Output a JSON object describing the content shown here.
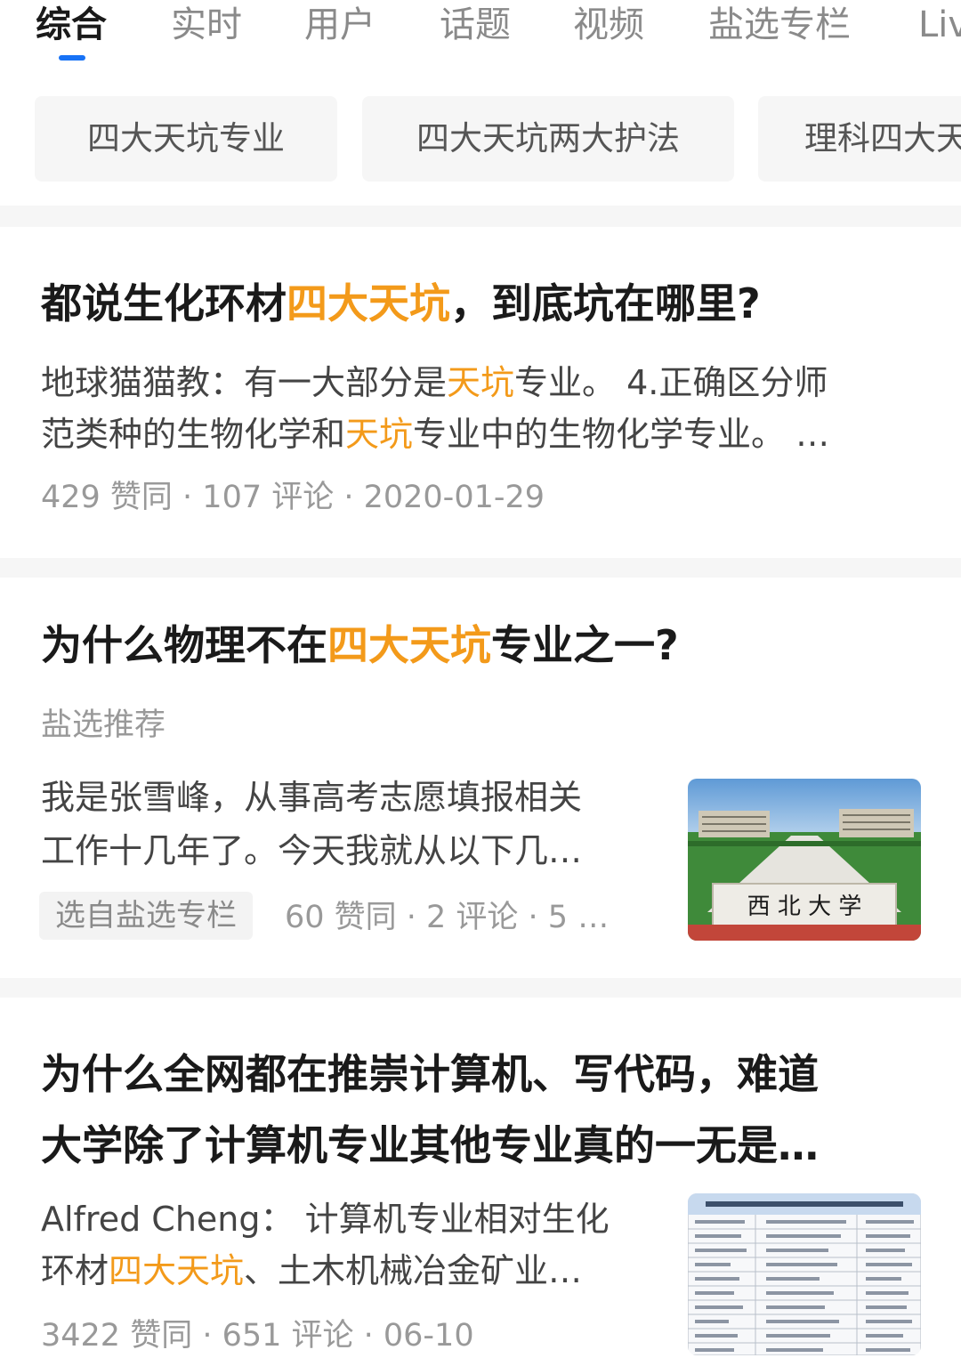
{
  "tabs": [
    {
      "label": "综合",
      "active": true
    },
    {
      "label": "实时"
    },
    {
      "label": "用户"
    },
    {
      "label": "话题"
    },
    {
      "label": "视频"
    },
    {
      "label": "盐选专栏"
    },
    {
      "label": "Live"
    }
  ],
  "chips": [
    "四大天坑专业",
    "四大天坑两大护法",
    "理科四大天坑"
  ],
  "results": [
    {
      "title_pre": "都说生化环材",
      "title_hl": "四大天坑",
      "title_post": "，到底坑在哪里?",
      "excerpt_line1_pre": "地球猫猫教：有一大部分是",
      "excerpt_line1_hl": "天坑",
      "excerpt_line1_post": "专业。 4.正确区分师",
      "excerpt_line2_pre": "范类种的生物化学和",
      "excerpt_line2_hl": "天坑",
      "excerpt_line2_post": "专业中的生物化学专业。 …",
      "meta": "429 赞同 · 107 评论 · 2020-01-29"
    },
    {
      "title_pre": "为什么物理不在",
      "title_hl": "四大天坑",
      "title_post": "专业之一?",
      "tag": "盐选推荐",
      "excerpt_line1": "我是张雪峰，从事高考志愿填报相关",
      "excerpt_line2": "工作十几年了。今天我就从以下几…",
      "badge": "选自盐选专栏",
      "meta": "60 赞同 · 2 评论 · 5 …",
      "thumb_text": "西 北 大 学",
      "thumb_icon": "campus-photo"
    },
    {
      "title_line1": "为什么全网都在推崇计算机、写代码，难道",
      "title_line2": "大学除了计算机专业其他专业真的一无是…",
      "excerpt_line1": "Alfred Cheng： 计算机专业相对生化",
      "excerpt_line2_pre": "环材",
      "excerpt_line2_hl": "四大天坑",
      "excerpt_line2_post": "、土木机械冶金矿业…",
      "meta": "3422 赞同 · 651 评论 · 06-10",
      "thumb_icon": "table-document"
    }
  ],
  "colors": {
    "accent": "#1772f6",
    "highlight": "#f39a1a",
    "divider": "#f6f6f6"
  }
}
